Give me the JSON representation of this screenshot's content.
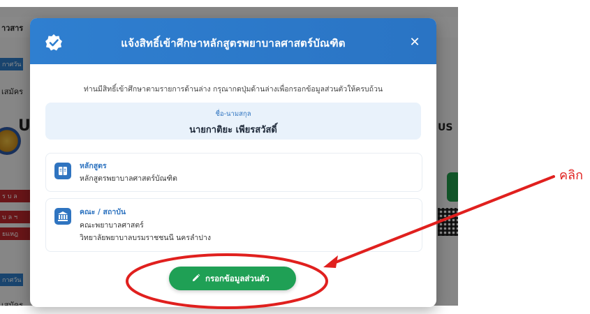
{
  "background": {
    "fragments": {
      "t1": "าวสาร",
      "t2": "กาศวัน",
      "t3": "เสมัคร",
      "t4": "U",
      "t5": "ร บ ล",
      "t6": "บ ล ฯ",
      "t7": "ยแหฎ",
      "t8": "US",
      "t9": "กาศวัน",
      "t10": "เสมัคร"
    }
  },
  "modal": {
    "title": "แจ้งสิทธิ์เข้าศึกษาหลักสูตรพยาบาลศาสตร์บัณฑิต",
    "close_label": "✕",
    "intro": "ท่านมีสิทธิ์เข้าศึกษาตามรายการด้านล่าง กรุณากดปุ่มด้านล่างเพื่อกรอกข้อมูลส่วนตัวให้ครบถ้วน",
    "name_label": "ชื่อ-นามสกุล",
    "name_value": "นายกาติยะ เพียรสวัสดิ์",
    "program": {
      "title": "หลักสูตร",
      "value": "หลักสูตรพยาบาลศาสตร์บัณฑิต"
    },
    "institution": {
      "title": "คณะ / สถาบัน",
      "faculty": "คณะพยาบาลศาสตร์",
      "college": "วิทยาลัยพยาบาลบรมราชชนนี นครลำปาง"
    },
    "primary_button": "กรอกข้อมูลส่วนตัว"
  },
  "annotation": {
    "label": "คลิก",
    "color": "#e0201e"
  },
  "colors": {
    "header_blue": "#2f7fd0",
    "accent_blue": "#2f74c0",
    "button_green": "#1fa055"
  }
}
